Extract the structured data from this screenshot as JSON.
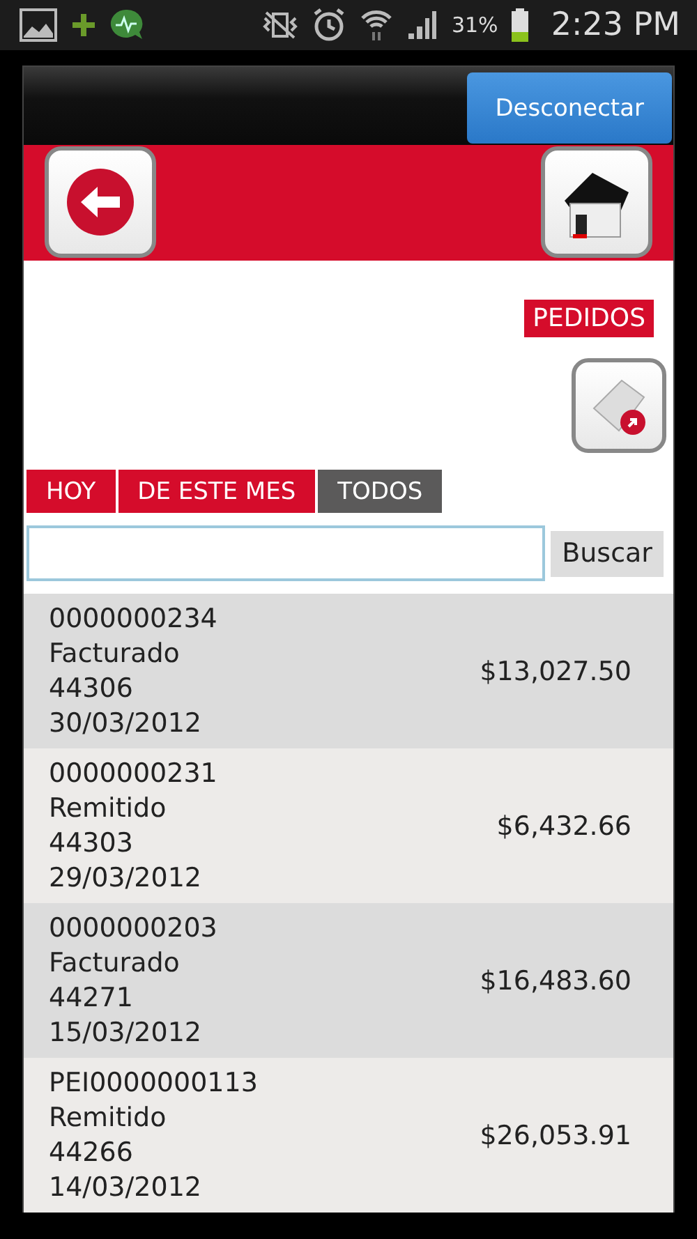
{
  "status_bar": {
    "battery": "31%",
    "time": "2:23 PM"
  },
  "header": {
    "logout_button": "Desconectar"
  },
  "section_title": "PEDIDOS",
  "tabs": [
    {
      "label": "HOY",
      "selected": false
    },
    {
      "label": "DE ESTE MES",
      "selected": false
    },
    {
      "label": "TODOS",
      "selected": true
    }
  ],
  "search": {
    "button": "Buscar"
  },
  "orders": [
    {
      "number": "0000000234",
      "status": "Facturado",
      "code": "44306",
      "date": "30/03/2012",
      "amount": "$13,027.50"
    },
    {
      "number": "0000000231",
      "status": "Remitido",
      "code": "44303",
      "date": "29/03/2012",
      "amount": "$6,432.66"
    },
    {
      "number": "0000000203",
      "status": "Facturado",
      "code": "44271",
      "date": "15/03/2012",
      "amount": "$16,483.60"
    },
    {
      "number": "PEI0000000113",
      "status": "Remitido",
      "code": "44266",
      "date": "14/03/2012",
      "amount": "$26,053.91"
    }
  ]
}
